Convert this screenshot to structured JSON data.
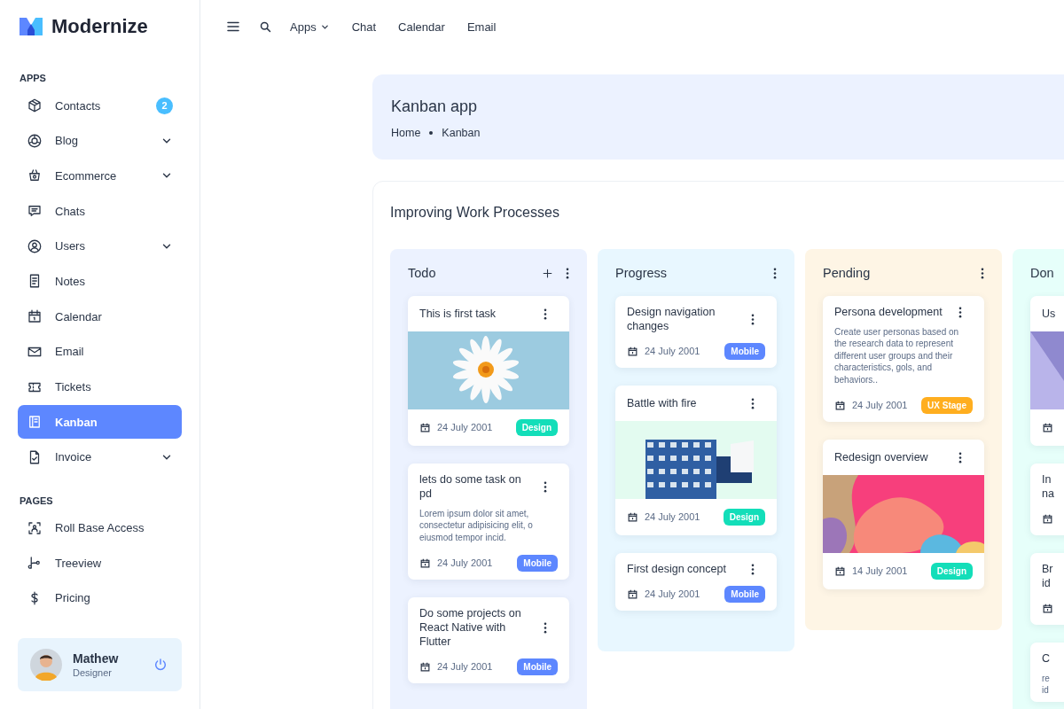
{
  "brand": {
    "name": "Modernize"
  },
  "topnav": {
    "items": [
      {
        "label": "Apps",
        "dropdown": true
      },
      {
        "label": "Chat",
        "dropdown": false
      },
      {
        "label": "Calendar",
        "dropdown": false
      },
      {
        "label": "Email",
        "dropdown": false
      }
    ]
  },
  "sidebar": {
    "sections": [
      {
        "title": "APPS",
        "items": [
          {
            "label": "Contacts",
            "badge": "2",
            "expandable": false,
            "selected": false
          },
          {
            "label": "Blog",
            "expandable": true,
            "selected": false
          },
          {
            "label": "Ecommerce",
            "expandable": true,
            "selected": false
          },
          {
            "label": "Chats",
            "expandable": false,
            "selected": false
          },
          {
            "label": "Users",
            "expandable": true,
            "selected": false
          },
          {
            "label": "Notes",
            "expandable": false,
            "selected": false
          },
          {
            "label": "Calendar",
            "expandable": false,
            "selected": false
          },
          {
            "label": "Email",
            "expandable": false,
            "selected": false
          },
          {
            "label": "Tickets",
            "expandable": false,
            "selected": false
          },
          {
            "label": "Kanban",
            "expandable": false,
            "selected": true
          },
          {
            "label": "Invoice",
            "expandable": true,
            "selected": false
          }
        ]
      },
      {
        "title": "PAGES",
        "items": [
          {
            "label": "Roll Base Access",
            "expandable": false,
            "selected": false
          },
          {
            "label": "Treeview",
            "expandable": false,
            "selected": false
          },
          {
            "label": "Pricing",
            "expandable": false,
            "selected": false
          }
        ]
      }
    ]
  },
  "profile": {
    "name": "Mathew",
    "role": "Designer"
  },
  "page_header": {
    "title": "Kanban app",
    "breadcrumb": [
      "Home",
      "Kanban"
    ]
  },
  "board": {
    "title": "Improving Work Processes",
    "columns": [
      {
        "title": "Todo",
        "color": "#ecf2ff",
        "add_button": true,
        "cards": [
          {
            "title": "This is first task",
            "date": "24 July 2001",
            "tag": {
              "label": "Design",
              "color": "#13deb9"
            }
          },
          {
            "kind": "text",
            "title": "lets do some task on pd",
            "description": "Lorem ipsum dolor sit amet, consectetur adipisicing elit, o eiusmod tempor incid.",
            "date": "24 July 2001",
            "tag": {
              "label": "Mobile",
              "color": "#5d87ff"
            }
          },
          {
            "kind": "text",
            "title": "Do some projects on React Native with Flutter",
            "date": "24 July 2001",
            "tag": {
              "label": "Mobile",
              "color": "#5d87ff"
            }
          }
        ]
      },
      {
        "title": "Progress",
        "color": "#e8f7ff",
        "add_button": false,
        "cards": [
          {
            "kind": "text",
            "title": "Design navigation changes",
            "date": "24 July 2001",
            "tag": {
              "label": "Mobile",
              "color": "#5d87ff"
            }
          },
          {
            "title": "Battle with fire",
            "date": "24 July 2001",
            "tag": {
              "label": "Design",
              "color": "#13deb9"
            }
          },
          {
            "kind": "text",
            "title": "First design concept",
            "date": "24 July 2001",
            "tag": {
              "label": "Mobile",
              "color": "#5d87ff"
            }
          }
        ]
      },
      {
        "title": "Pending",
        "color": "#fef5e5",
        "add_button": false,
        "cards": [
          {
            "kind": "text",
            "title": "Persona development",
            "description": "Create user personas based on the research data to represent different user groups and their characteristics, gols, and behaviors..",
            "date": "24 July 2001",
            "tag": {
              "label": "UX Stage",
              "color": "#ffae1f"
            }
          },
          {
            "title": "Redesign overview",
            "date": "14 July 2001",
            "tag": {
              "label": "Design",
              "color": "#13deb9"
            }
          }
        ]
      },
      {
        "title": "Don",
        "color": "#e6fffa",
        "add_button": false,
        "cards": [
          {
            "title": "Us"
          },
          {
            "kind": "text",
            "title": "In\nna"
          },
          {
            "kind": "text",
            "title": "Br\nid"
          },
          {
            "kind": "text",
            "title": "C",
            "description": "re\nid"
          }
        ]
      }
    ]
  }
}
